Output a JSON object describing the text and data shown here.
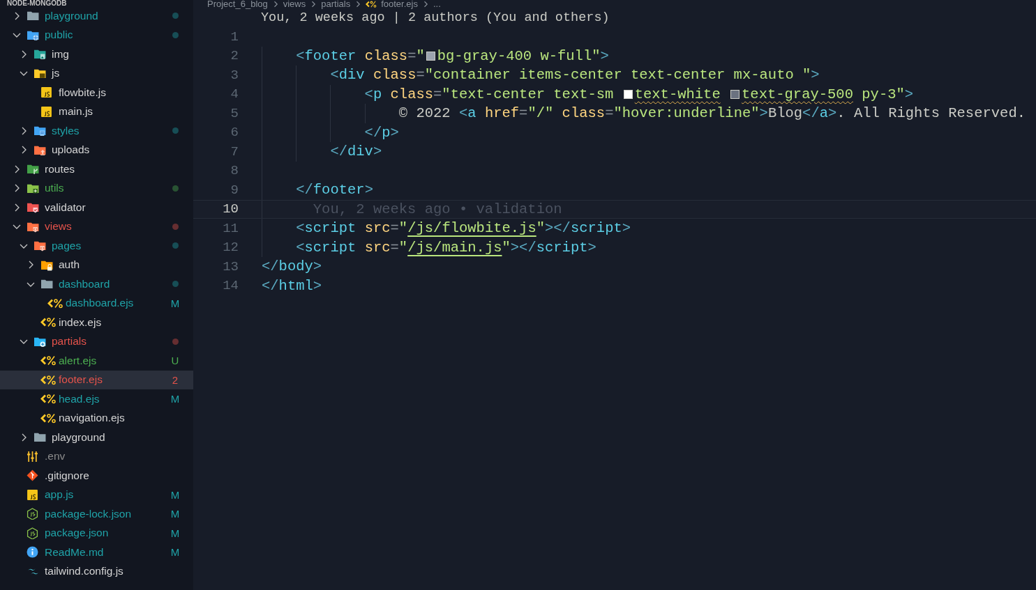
{
  "explorer": {
    "title": "NODE-MONGODB",
    "tree": [
      {
        "name": "playground",
        "kind": "folder",
        "expanded": false,
        "color": "#1fa3a8",
        "dot": true,
        "selected": false
      },
      {
        "name": "public",
        "kind": "folder-public",
        "expanded": true,
        "color": "#1fa3a8",
        "dot": true,
        "selected": false,
        "children": [
          {
            "name": "img",
            "kind": "folder-images",
            "expanded": false,
            "color": "#d4d4d4",
            "selected": false
          },
          {
            "name": "js",
            "kind": "folder-js",
            "expanded": true,
            "color": "#d4d4d4",
            "selected": false,
            "children": [
              {
                "name": "flowbite.js",
                "kind": "js",
                "color": "#d4d4d4",
                "selected": false
              },
              {
                "name": "main.js",
                "kind": "js",
                "color": "#d4d4d4",
                "selected": false
              }
            ]
          },
          {
            "name": "styles",
            "kind": "folder-styles",
            "expanded": false,
            "color": "#1fa3a8",
            "dot": true,
            "selected": false
          },
          {
            "name": "uploads",
            "kind": "folder-uploads",
            "expanded": false,
            "color": "#d4d4d4",
            "selected": false
          }
        ]
      },
      {
        "name": "routes",
        "kind": "folder-routes",
        "expanded": false,
        "color": "#d4d4d4",
        "selected": false
      },
      {
        "name": "utils",
        "kind": "folder-utils",
        "expanded": false,
        "color": "#4caf50",
        "dot": true,
        "selected": false
      },
      {
        "name": "validator",
        "kind": "folder-validator",
        "expanded": false,
        "color": "#d4d4d4",
        "selected": false
      },
      {
        "name": "views",
        "kind": "folder-views",
        "expanded": true,
        "color": "#e5534b",
        "dot": true,
        "selected": false,
        "children": [
          {
            "name": "pages",
            "kind": "folder-views",
            "expanded": true,
            "color": "#1fa3a8",
            "dot": true,
            "selected": false,
            "children": [
              {
                "name": "auth",
                "kind": "folder-lock",
                "expanded": false,
                "color": "#d4d4d4",
                "selected": false
              },
              {
                "name": "dashboard",
                "kind": "folder",
                "expanded": true,
                "color": "#1fa3a8",
                "dot": true,
                "selected": false,
                "children": [
                  {
                    "name": "dashboard.ejs",
                    "kind": "ejs",
                    "color": "#1fa3a8",
                    "badge": "M",
                    "selected": false
                  }
                ]
              },
              {
                "name": "index.ejs",
                "kind": "ejs",
                "color": "#d4d4d4",
                "selected": false
              }
            ]
          },
          {
            "name": "partials",
            "kind": "folder-partials",
            "expanded": true,
            "color": "#e5534b",
            "dot": true,
            "selected": false,
            "children": [
              {
                "name": "alert.ejs",
                "kind": "ejs",
                "color": "#4caf50",
                "badge": "U",
                "selected": false
              },
              {
                "name": "footer.ejs",
                "kind": "ejs",
                "color": "#e5534b",
                "badge": "2",
                "selected": true
              },
              {
                "name": "head.ejs",
                "kind": "ejs",
                "color": "#1fa3a8",
                "badge": "M",
                "selected": false
              },
              {
                "name": "navigation.ejs",
                "kind": "ejs",
                "color": "#d4d4d4",
                "selected": false
              }
            ]
          },
          {
            "name": "playground",
            "kind": "folder",
            "expanded": false,
            "color": "#d4d4d4",
            "selected": false
          }
        ]
      },
      {
        "name": ".env",
        "kind": "env",
        "color": "#8b8b8b",
        "selected": false
      },
      {
        "name": ".gitignore",
        "kind": "git",
        "color": "#d4d4d4",
        "selected": false
      },
      {
        "name": "app.js",
        "kind": "js",
        "color": "#1fa3a8",
        "badge": "M",
        "selected": false
      },
      {
        "name": "package-lock.json",
        "kind": "node",
        "color": "#1fa3a8",
        "badge": "M",
        "selected": false
      },
      {
        "name": "package.json",
        "kind": "node",
        "color": "#1fa3a8",
        "badge": "M",
        "selected": false
      },
      {
        "name": "ReadMe.md",
        "kind": "info",
        "color": "#1fa3a8",
        "badge": "M",
        "selected": false
      },
      {
        "name": "tailwind.config.js",
        "kind": "tailwind",
        "color": "#d4d4d4",
        "selected": false
      }
    ]
  },
  "editor": {
    "breadcrumbs": [
      "Project_6_blog",
      "views",
      "partials",
      "footer.ejs",
      "..."
    ],
    "codelens": "You, 2 weeks ago | 2 authors (You and others)",
    "lines": [
      {
        "number": "1",
        "current": false
      },
      {
        "number": "2",
        "current": false,
        "tokens": [
          {
            "text": "    <",
            "kind": "punct"
          },
          {
            "text": "footer",
            "kind": "tag"
          },
          {
            "text": " class",
            "kind": "attr"
          },
          {
            "text": "=",
            "kind": "op"
          },
          {
            "text": "\"",
            "kind": "string"
          },
          {
            "kind": "swatch",
            "color": "#9ca3af"
          },
          {
            "text": "bg-gray-400 w-full\"",
            "kind": "string"
          },
          {
            "text": ">",
            "kind": "punct"
          }
        ]
      },
      {
        "number": "3",
        "current": false,
        "tokens": [
          {
            "text": "        <",
            "kind": "punct"
          },
          {
            "text": "div",
            "kind": "tag"
          },
          {
            "text": " class",
            "kind": "attr"
          },
          {
            "text": "=",
            "kind": "op"
          },
          {
            "text": "\"container items-center text-center mx-auto \"",
            "kind": "string"
          },
          {
            "text": ">",
            "kind": "punct"
          }
        ]
      },
      {
        "number": "4",
        "current": false,
        "tokens": [
          {
            "text": "            <",
            "kind": "punct"
          },
          {
            "text": "p",
            "kind": "tag"
          },
          {
            "text": " class",
            "kind": "attr"
          },
          {
            "text": "=",
            "kind": "op"
          },
          {
            "text": "\"text-center text-sm ",
            "kind": "string"
          },
          {
            "kind": "swatch",
            "color": "#ffffff"
          },
          {
            "text": "text-white ",
            "kind": "string",
            "squiggle": true
          },
          {
            "kind": "swatch",
            "color": "#6b7280"
          },
          {
            "text": "text-gray-500",
            "kind": "string",
            "squiggle": true
          },
          {
            "text": " py-3\"",
            "kind": "string"
          },
          {
            "text": ">",
            "kind": "punct"
          }
        ]
      },
      {
        "number": "5",
        "current": false,
        "tokens": [
          {
            "text": "                © 2022 ",
            "kind": "text"
          },
          {
            "text": "<",
            "kind": "punct"
          },
          {
            "text": "a",
            "kind": "tag"
          },
          {
            "text": " href",
            "kind": "attr"
          },
          {
            "text": "=",
            "kind": "op"
          },
          {
            "text": "\"/\"",
            "kind": "string"
          },
          {
            "text": " class",
            "kind": "attr"
          },
          {
            "text": "=",
            "kind": "op"
          },
          {
            "text": "\"hover:underline\"",
            "kind": "string"
          },
          {
            "text": ">",
            "kind": "punct"
          },
          {
            "text": "Blog",
            "kind": "text"
          },
          {
            "text": "</",
            "kind": "punct"
          },
          {
            "text": "a",
            "kind": "tag"
          },
          {
            "text": ">",
            "kind": "punct"
          },
          {
            "text": ". All Rights Reserved.",
            "kind": "text"
          }
        ]
      },
      {
        "number": "6",
        "current": false,
        "tokens": [
          {
            "text": "            </",
            "kind": "punct"
          },
          {
            "text": "p",
            "kind": "tag"
          },
          {
            "text": ">",
            "kind": "punct"
          }
        ]
      },
      {
        "number": "7",
        "current": false,
        "tokens": [
          {
            "text": "        </",
            "kind": "punct"
          },
          {
            "text": "div",
            "kind": "tag"
          },
          {
            "text": ">",
            "kind": "punct"
          }
        ]
      },
      {
        "number": "8",
        "current": false
      },
      {
        "number": "9",
        "current": false,
        "tokens": [
          {
            "text": "    </",
            "kind": "punct"
          },
          {
            "text": "footer",
            "kind": "tag"
          },
          {
            "text": ">",
            "kind": "punct"
          }
        ]
      },
      {
        "number": "10",
        "current": true,
        "tokens": [
          {
            "text": "      You, 2 weeks ago • validation",
            "kind": "blame"
          }
        ]
      },
      {
        "number": "11",
        "current": false,
        "tokens": [
          {
            "text": "    <",
            "kind": "punct"
          },
          {
            "text": "script",
            "kind": "tag"
          },
          {
            "text": " src",
            "kind": "attr"
          },
          {
            "text": "=",
            "kind": "op"
          },
          {
            "text": "\"",
            "kind": "string"
          },
          {
            "text": "/js/flowbite.js",
            "kind": "string",
            "underline": true
          },
          {
            "text": "\"",
            "kind": "string"
          },
          {
            "text": "></",
            "kind": "punct"
          },
          {
            "text": "script",
            "kind": "tag"
          },
          {
            "text": ">",
            "kind": "punct"
          }
        ]
      },
      {
        "number": "12",
        "current": false,
        "tokens": [
          {
            "text": "    <",
            "kind": "punct"
          },
          {
            "text": "script",
            "kind": "tag"
          },
          {
            "text": " src",
            "kind": "attr"
          },
          {
            "text": "=",
            "kind": "op"
          },
          {
            "text": "\"",
            "kind": "string"
          },
          {
            "text": "/js/main.js",
            "kind": "string",
            "underline": true
          },
          {
            "text": "\"",
            "kind": "string"
          },
          {
            "text": "></",
            "kind": "punct"
          },
          {
            "text": "script",
            "kind": "tag"
          },
          {
            "text": ">",
            "kind": "punct"
          }
        ]
      },
      {
        "number": "13",
        "current": false,
        "tokens": [
          {
            "text": "</",
            "kind": "punct"
          },
          {
            "text": "body",
            "kind": "tag"
          },
          {
            "text": ">",
            "kind": "punct"
          }
        ]
      },
      {
        "number": "14",
        "current": false,
        "tokens": [
          {
            "text": "</",
            "kind": "punct"
          },
          {
            "text": "html",
            "kind": "tag"
          },
          {
            "text": ">",
            "kind": "punct"
          }
        ]
      }
    ]
  }
}
